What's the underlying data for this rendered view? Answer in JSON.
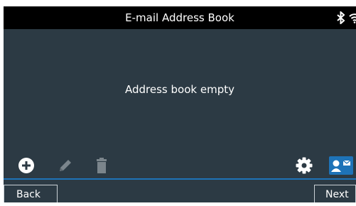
{
  "header": {
    "title": "E-mail Address Book",
    "status_icons": [
      "bluetooth-icon",
      "wifi-icon"
    ]
  },
  "main": {
    "message": "Address book empty"
  },
  "toolbar": {
    "items": [
      {
        "icon": "add-icon",
        "enabled": true
      },
      {
        "icon": "edit-icon",
        "enabled": false
      },
      {
        "icon": "delete-icon",
        "enabled": false
      },
      {
        "icon": "gear-icon",
        "enabled": true
      },
      {
        "icon": "contact-card-icon",
        "enabled": true
      }
    ]
  },
  "footer": {
    "back_label": "Back",
    "next_label": "Next"
  },
  "colors": {
    "background": "#2c3a44",
    "titlebar": "#000000",
    "accent": "#1e73b8",
    "disabled": "#7b858c"
  }
}
